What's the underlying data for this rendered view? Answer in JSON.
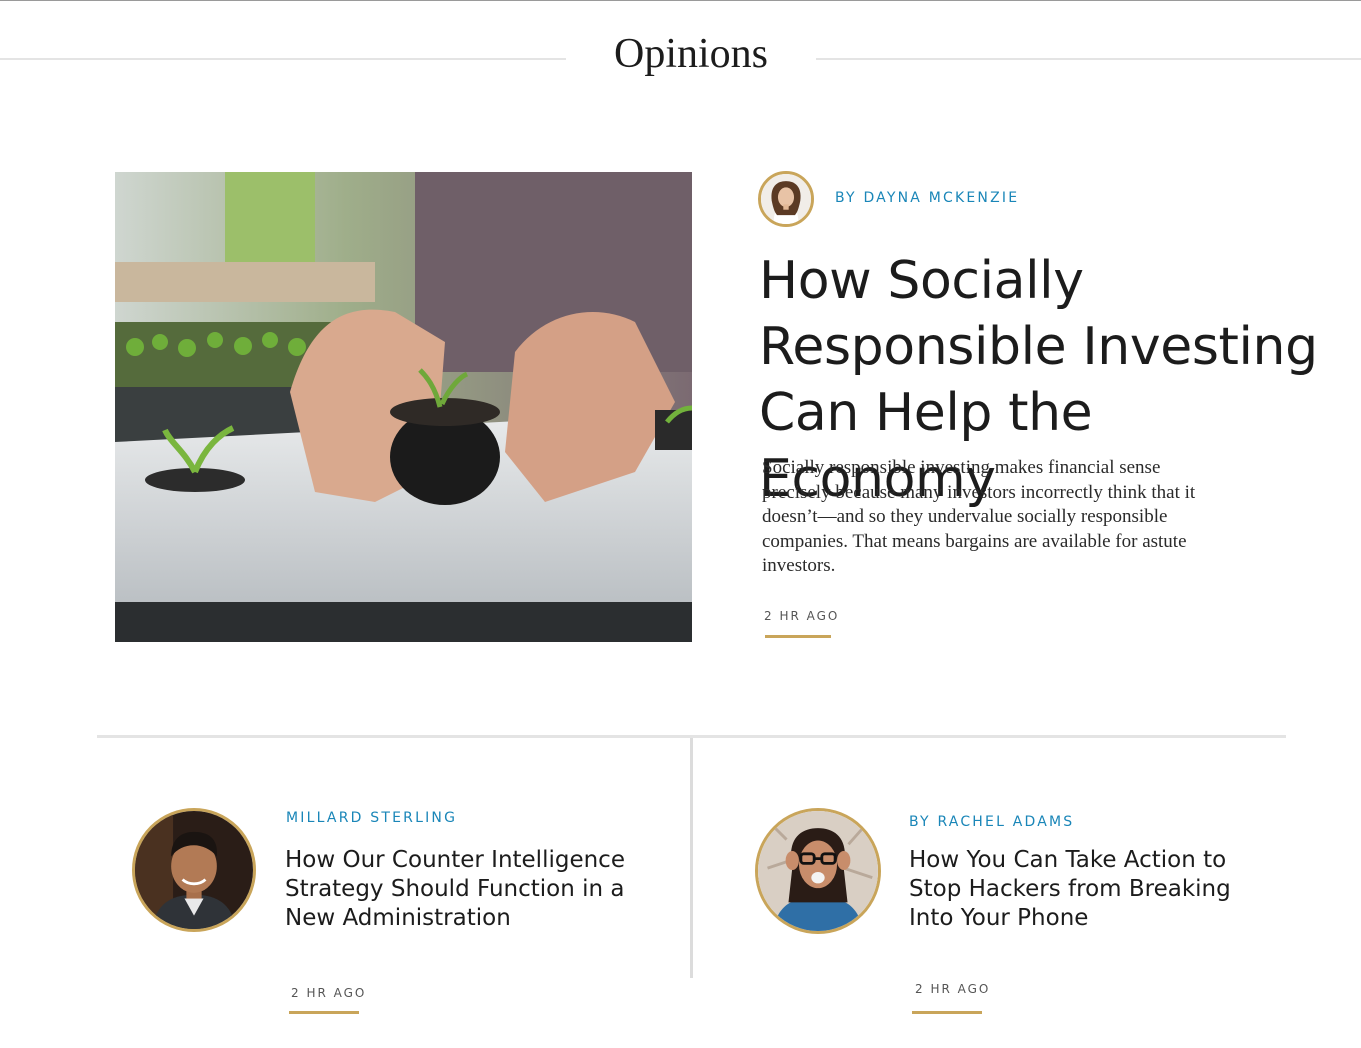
{
  "section": {
    "title": "Opinions"
  },
  "featured": {
    "image_alt": "Hands planting a seedling in a small pot",
    "author": "BY DAYNA MCKENZIE",
    "headline": "How Socially Responsible Investing Can Help the Economy",
    "excerpt": "Socially responsible investing makes financial sense precisely because many investors incorrectly think that it doesn’t—and so they undervalue socially responsible companies. That means bargains are available for astute investors.",
    "time": "2 HR AGO"
  },
  "articles": [
    {
      "author": "MILLARD STERLING",
      "headline": "How Our Counter Intelligence Strategy Should Function in a New Administration",
      "time": "2 HR AGO"
    },
    {
      "author": "BY RACHEL ADAMS",
      "headline": "How You Can Take Action to Stop Hackers from Breaking Into Your Phone",
      "time": "2 HR AGO"
    }
  ],
  "colors": {
    "accent_gold": "#c9a55a",
    "byline_blue": "#1a86b8",
    "divider": "#e4e4e4"
  }
}
